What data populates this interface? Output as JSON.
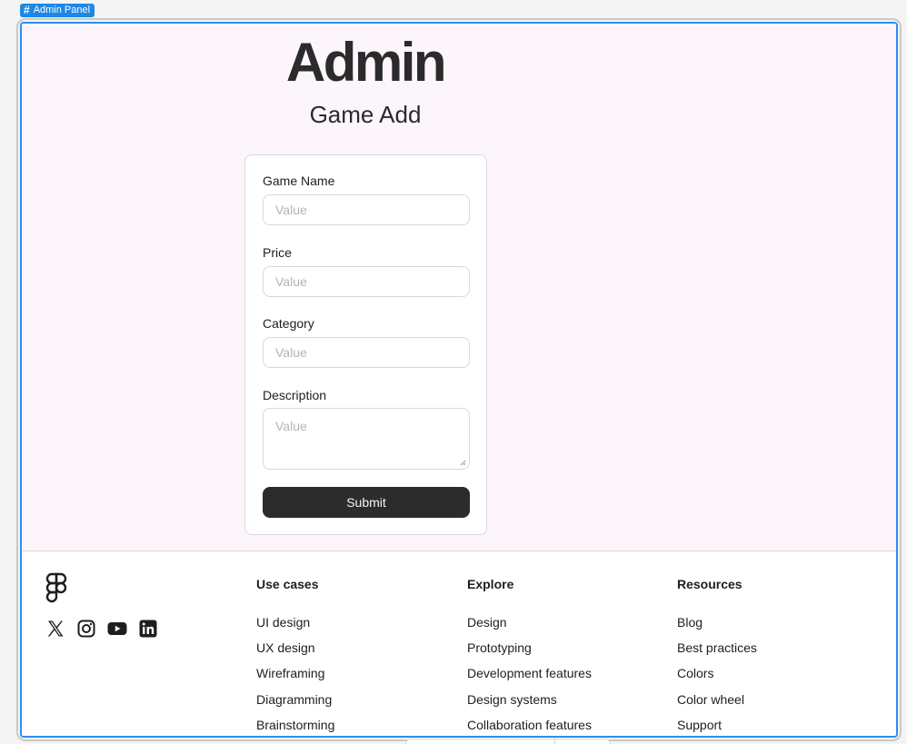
{
  "frame": {
    "label": "Admin Panel",
    "icon": "frame-hash-icon"
  },
  "hero": {
    "title": "Admin",
    "subtitle": "Game Add"
  },
  "form": {
    "fields": [
      {
        "label": "Game Name",
        "placeholder": "Value"
      },
      {
        "label": "Price",
        "placeholder": "Value"
      },
      {
        "label": "Category",
        "placeholder": "Value"
      },
      {
        "label": "Description",
        "placeholder": "Value"
      }
    ],
    "submit_label": "Submit"
  },
  "footer": {
    "logo_icon": "figma-logo-icon",
    "socials": [
      "x-icon",
      "instagram-icon",
      "youtube-icon",
      "linkedin-icon"
    ],
    "columns": [
      {
        "title": "Use cases",
        "links": [
          "UI design",
          "UX design",
          "Wireframing",
          "Diagramming",
          "Brainstorming"
        ]
      },
      {
        "title": "Explore",
        "links": [
          "Design",
          "Prototyping",
          "Development features",
          "Design systems",
          "Collaboration features"
        ]
      },
      {
        "title": "Resources",
        "links": [
          "Blog",
          "Best practices",
          "Colors",
          "Color wheel",
          "Support"
        ]
      }
    ]
  },
  "colors": {
    "accent": "#2e8ff0",
    "hero_bg": "#fcf5fc",
    "button_bg": "#2c2c2c"
  }
}
